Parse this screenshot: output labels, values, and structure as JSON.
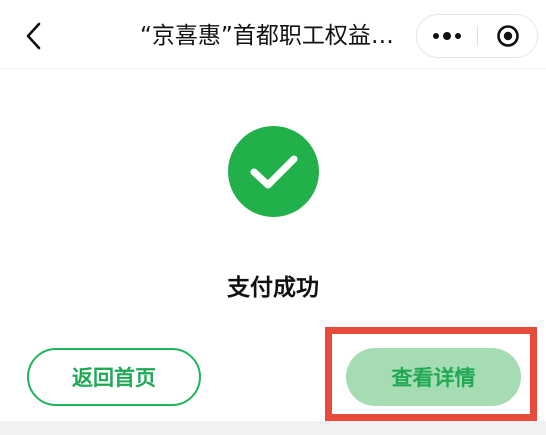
{
  "navbar": {
    "title": "“京喜惠”首都职工权益…",
    "back_icon": "chevron-left-icon",
    "more_icon": "more-dots-icon",
    "close_icon": "target-circle-icon"
  },
  "result": {
    "status_text": "支付成功",
    "icon": "check-circle-icon",
    "icon_color": "#22b04b"
  },
  "actions": {
    "home_label": "返回首页",
    "detail_label": "查看详情",
    "accent_color": "#21b55a",
    "highlight_color": "#e84a3c"
  }
}
